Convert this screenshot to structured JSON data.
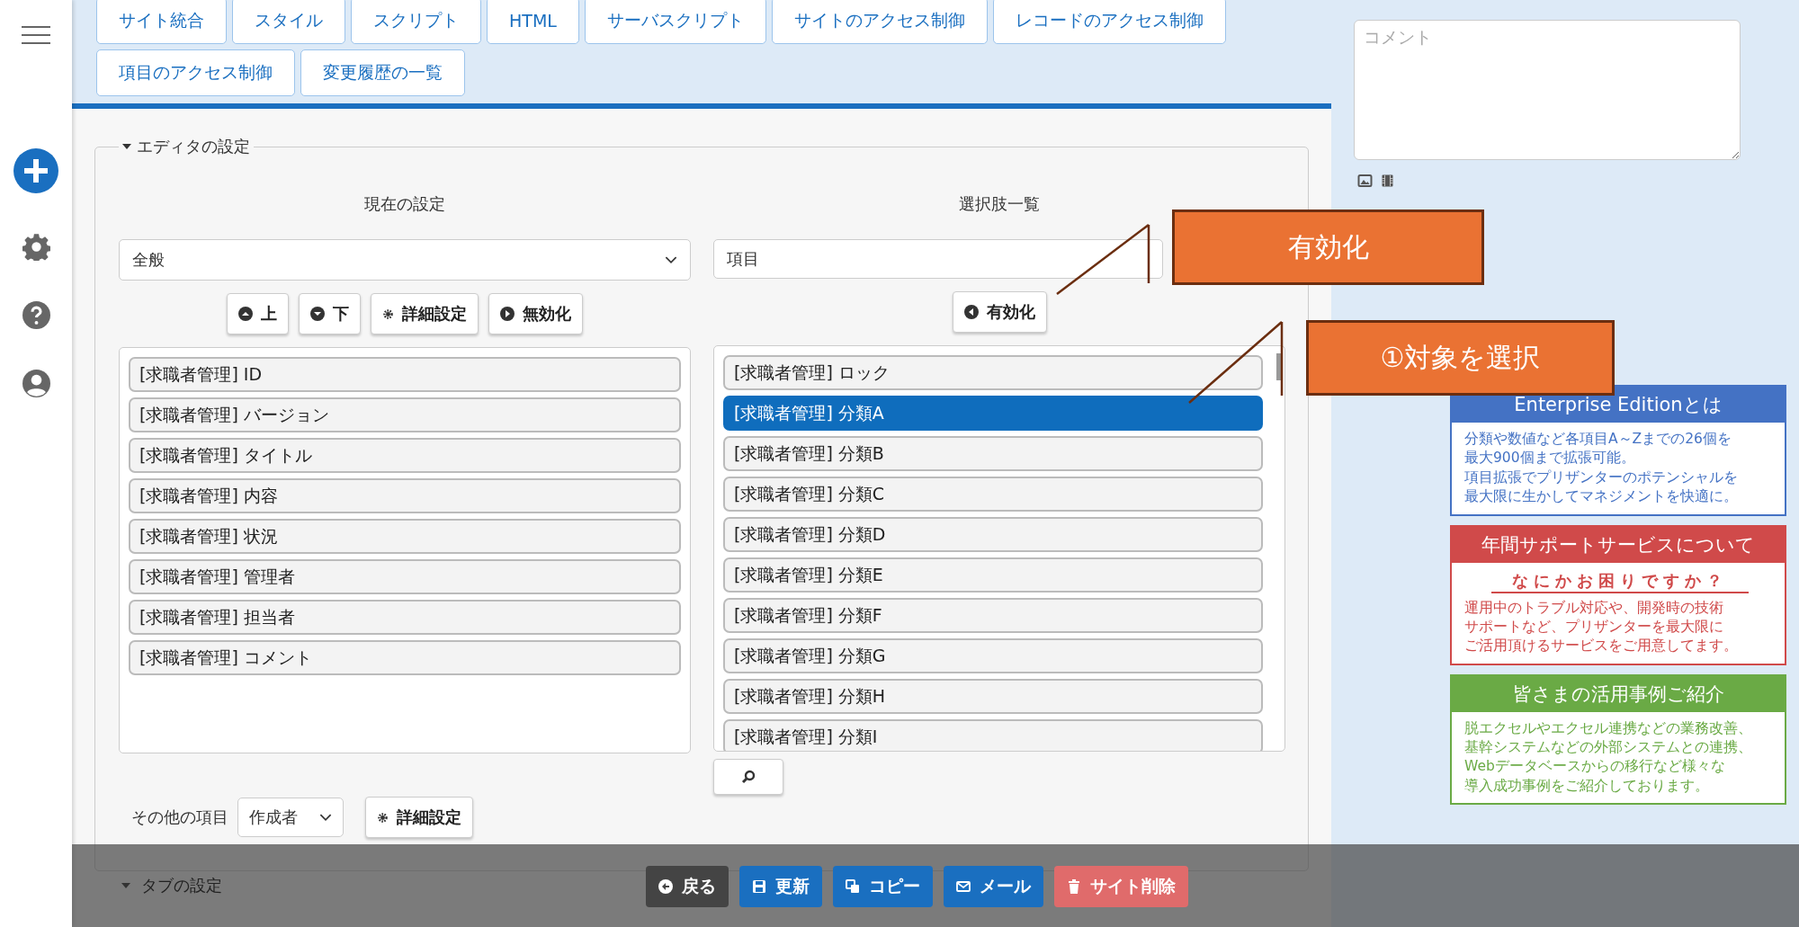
{
  "nav_buttons": [
    "サイト統合",
    "スタイル",
    "スクリプト",
    "HTML",
    "サーバスクリプト",
    "サイトのアクセス制御",
    "レコードのアクセス制御",
    "項目のアクセス制御",
    "変更履歴の一覧"
  ],
  "editor": {
    "legend": "エディタの設定",
    "current": {
      "heading": "現在の設定",
      "select_value": "全般",
      "buttons": [
        {
          "kind": "up",
          "label": "上"
        },
        {
          "kind": "down",
          "label": "下"
        },
        {
          "kind": "settings",
          "label": "詳細設定"
        },
        {
          "kind": "disable",
          "label": "無効化"
        }
      ],
      "items": [
        "[求職者管理] ID",
        "[求職者管理] バージョン",
        "[求職者管理] タイトル",
        "[求職者管理] 内容",
        "[求職者管理] 状況",
        "[求職者管理] 管理者",
        "[求職者管理] 担当者",
        "[求職者管理] コメント"
      ]
    },
    "choices": {
      "heading": "選択肢一覧",
      "select_value": "項目",
      "buttons": [
        {
          "kind": "enable",
          "label": "有効化"
        }
      ],
      "items": [
        {
          "label": "[求職者管理] ロック",
          "selected": false
        },
        {
          "label": "[求職者管理] 分類A",
          "selected": true
        },
        {
          "label": "[求職者管理] 分類B",
          "selected": false
        },
        {
          "label": "[求職者管理] 分類C",
          "selected": false
        },
        {
          "label": "[求職者管理] 分類D",
          "selected": false
        },
        {
          "label": "[求職者管理] 分類E",
          "selected": false
        },
        {
          "label": "[求職者管理] 分類F",
          "selected": false
        },
        {
          "label": "[求職者管理] 分類G",
          "selected": false
        },
        {
          "label": "[求職者管理] 分類H",
          "selected": false
        },
        {
          "label": "[求職者管理] 分類I",
          "selected": false
        }
      ]
    },
    "other": {
      "label": "その他の項目",
      "select_value": "作成者",
      "button": "詳細設定"
    }
  },
  "next_section": {
    "legend": "タブの設定"
  },
  "comment": {
    "placeholder": "コメント"
  },
  "info_boxes": [
    {
      "color": "#4472c4",
      "title": "Enterprise Editionとは",
      "lines": [
        "分類や数値など各項目A～Zまでの26個を",
        "最大900個まで拡張可能。",
        "項目拡張でプリザンターのポテンシャルを",
        "最大限に生かしてマネジメントを快適に。"
      ]
    },
    {
      "color": "#d04a4a",
      "title": "年間サポートサービスについて",
      "subtitle": "なにかお困りですか？",
      "lines": [
        "運用中のトラブル対応や、開発時の技術",
        "サポートなど、プリザンターを最大限に",
        "ご活用頂けるサービスをご用意してます。"
      ]
    },
    {
      "color": "#6aaa45",
      "title": "皆さまの活用事例ご紹介",
      "lines": [
        "脱エクセルやエクセル連携などの業務改善、",
        "基幹システムなどの外部システムとの連携、",
        "Webデータベースからの移行など様々な",
        "導入成功事例をご紹介しております。"
      ]
    }
  ],
  "actions": [
    {
      "kind": "back",
      "label": "戻る"
    },
    {
      "kind": "update",
      "label": "更新"
    },
    {
      "kind": "copy",
      "label": "コピー"
    },
    {
      "kind": "mail",
      "label": "メール"
    },
    {
      "kind": "delete",
      "label": "サイト削除"
    }
  ],
  "callouts": [
    {
      "text": "有効化"
    },
    {
      "text": "①対象を選択"
    }
  ]
}
